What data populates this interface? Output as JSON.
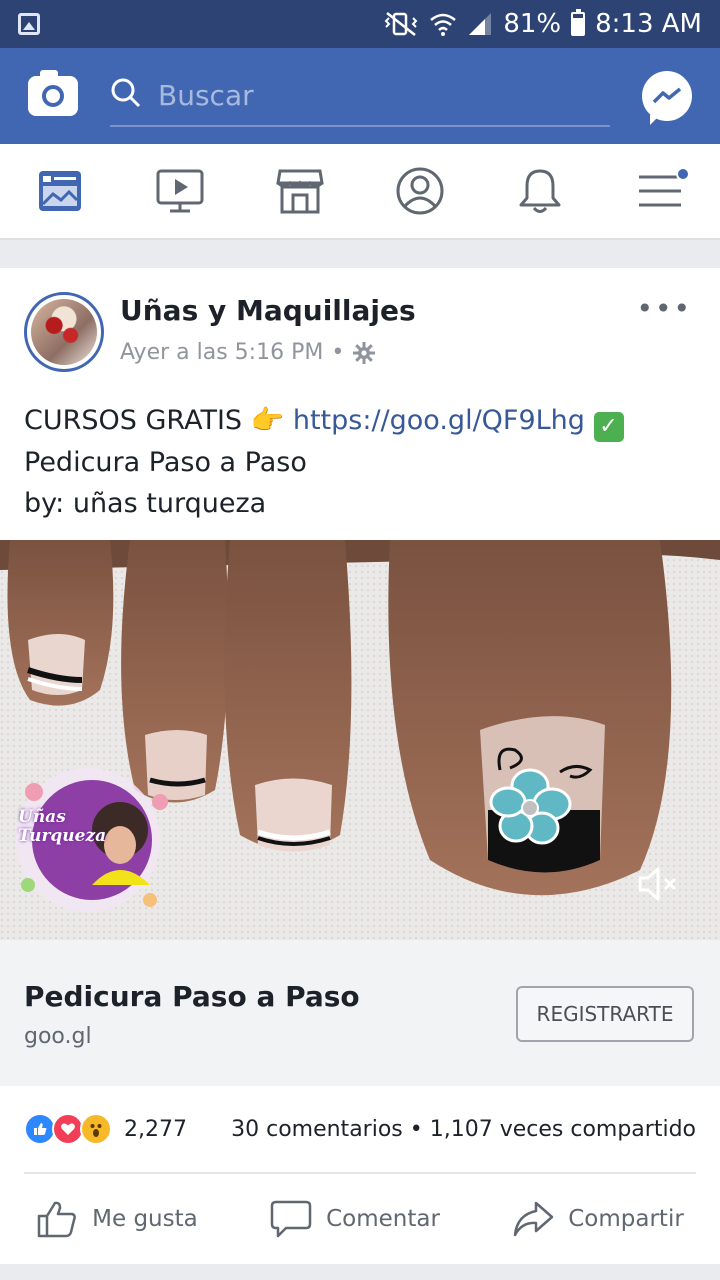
{
  "status_bar": {
    "battery": "81%",
    "battery_level": 0.81,
    "time": "8:13 AM"
  },
  "header": {
    "search_placeholder": "Buscar"
  },
  "tabs": [
    {
      "name": "news-feed"
    },
    {
      "name": "watch"
    },
    {
      "name": "marketplace"
    },
    {
      "name": "profile"
    },
    {
      "name": "notifications"
    },
    {
      "name": "menu",
      "has_badge": true
    }
  ],
  "post": {
    "page_name": "Uñas y Maquillajes",
    "timestamp": "Ayer a las 5:16 PM",
    "separator": "•",
    "more": "•••",
    "text_line1_prefix": "CURSOS GRATIS",
    "text_line1_emoji": "👉",
    "link": "https://goo.gl/QF9Lhg",
    "check_emoji": "✓",
    "text_line2": "Pedicura Paso a Paso",
    "text_line3": "by: uñas turqueza",
    "watermark": "Uñas Turqueza",
    "link_preview": {
      "title": "Pedicura Paso a Paso",
      "domain": "goo.gl",
      "cta": "REGISTRARTE"
    },
    "reactions": {
      "count": "2,277",
      "comments": "30 comentarios",
      "dot": "•",
      "shares": "1,107 veces compartido"
    },
    "actions": {
      "like": "Me gusta",
      "comment": "Comentar",
      "share": "Compartir"
    }
  },
  "colors": {
    "status_bar": "#2d4373",
    "header": "#4267b2",
    "link": "#385898"
  }
}
